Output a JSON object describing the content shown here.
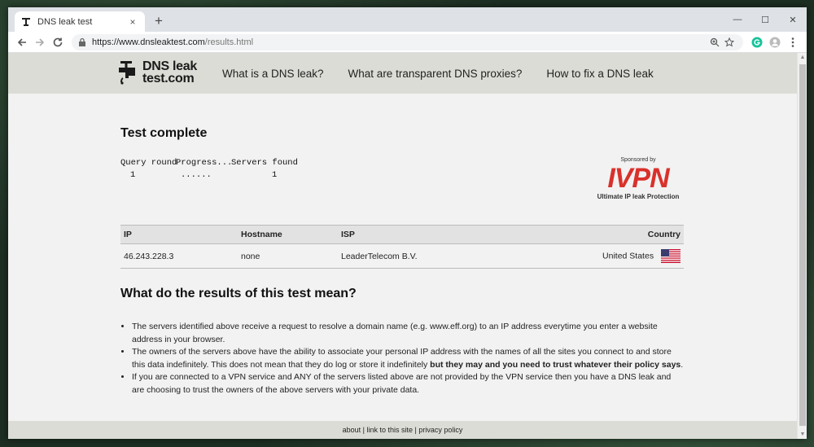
{
  "browser": {
    "tab_title": "DNS leak test",
    "tab_close": "×",
    "new_tab": "+",
    "url_host": "https://www.dnsleaktest.com",
    "url_path": "/results.html",
    "minimize": "—",
    "maximize": "☐",
    "close": "✕"
  },
  "site": {
    "logo_line1": "DNS leak",
    "logo_line2": "test.com",
    "nav": [
      "What is a DNS leak?",
      "What are transparent DNS proxies?",
      "How to fix a DNS leak"
    ]
  },
  "test": {
    "title": "Test complete",
    "progress_headers": [
      "Query round",
      "Progress...",
      "Servers found"
    ],
    "progress_row": [
      "1",
      "......",
      "1"
    ]
  },
  "sponsor": {
    "label": "Sponsored by",
    "brand": "IVPN",
    "tagline": "Ultimate IP leak Protection",
    "brand_color": "#d9312b"
  },
  "results": {
    "headers": [
      "IP",
      "Hostname",
      "ISP",
      "Country"
    ],
    "rows": [
      {
        "ip": "46.243.228.3",
        "hostname": "none",
        "isp": "LeaderTelecom B.V.",
        "country": "United States",
        "flag": "us-flag-icon"
      }
    ]
  },
  "meaning": {
    "title": "What do the results of this test mean?",
    "items": [
      {
        "text": "The servers identified above receive a request to resolve a domain name (e.g. www.eff.org) to an IP address everytime you enter a website address in your browser.",
        "bold": ""
      },
      {
        "text": "The owners of the servers above have the ability to associate your personal IP address with the names of all the sites you connect to and store this data indefinitely. This does not mean that they do log or store it indefinitely ",
        "bold": "but they may and you need to trust whatever their policy says",
        "tail": "."
      },
      {
        "text": "If you are connected to a VPN service and ANY of the servers listed above are not provided by the VPN service then you have a DNS leak and are choosing to trust the owners of the above servers with your private data.",
        "bold": ""
      }
    ]
  },
  "footer": {
    "about": "about",
    "link": "link to this site",
    "privacy": "privacy policy",
    "sep": " | "
  }
}
